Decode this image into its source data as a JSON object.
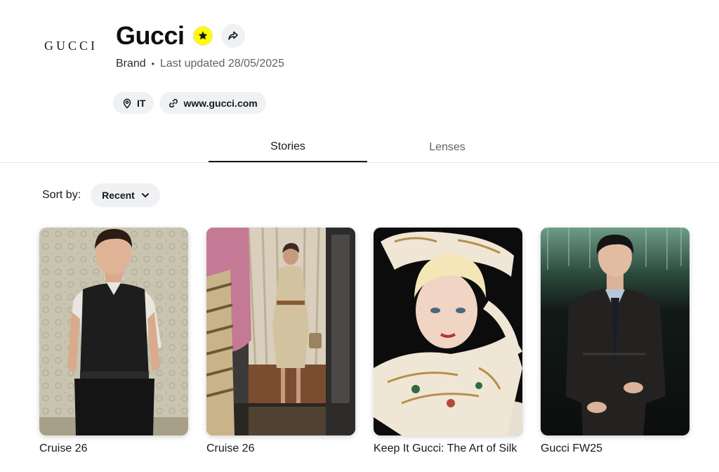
{
  "brand": {
    "logo_text": "GUCCI",
    "name": "Gucci",
    "type": "Brand",
    "separator": "•",
    "last_updated": "Last updated 28/05/2025"
  },
  "chips": {
    "location": "IT",
    "website": "www.gucci.com"
  },
  "tabs": [
    {
      "label": "Stories",
      "active": true
    },
    {
      "label": "Lenses",
      "active": false
    }
  ],
  "sort": {
    "label": "Sort by:",
    "value": "Recent"
  },
  "stories": [
    {
      "title": "Cruise 26"
    },
    {
      "title": "Cruise 26"
    },
    {
      "title": "Keep It Gucci: The Art of Silk"
    },
    {
      "title": "Gucci FW25"
    }
  ],
  "colors": {
    "verified_badge": "#fffc00",
    "chip_bg": "#f0f1f3",
    "text_primary": "#16191c",
    "text_secondary": "#5e6267"
  }
}
